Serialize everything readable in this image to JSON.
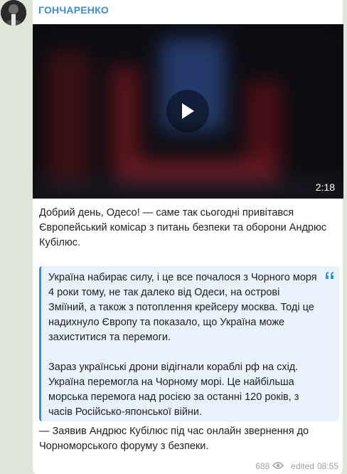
{
  "channel": {
    "author": "ГОНЧАРЕНКО"
  },
  "video": {
    "duration": "2:18"
  },
  "message": {
    "intro": "Добрий день, Одесо! — саме так сьогодні привітався Європейський комісар з питань безпеки та оборони Андрюс Кубілюс.",
    "quote_paragraph_1": "Україна набирає силу, і це все почалося з Чорного моря 4 роки тому, не так далеко від Одеси, на острові Зміїний, а також з потоплення крейсеру москва. Тоді це надихнуло Європу та показало, що Україна може захиститися та перемоги.",
    "quote_paragraph_2": "Зараз українські дрони відігнали кораблі рф на схід. Україна перемогла на Чорному морі. Це найбільша морська перемога над росією за останні 120 років, з часів Російсько-японської війни.",
    "outro": "— Заявив Андрюс Кубілюс під час онлайн звернення до Чорноморського форуму з безпеки."
  },
  "footer": {
    "views": "688",
    "edited_label": "edited",
    "time": "08:55"
  },
  "icons": {
    "play": "play-icon",
    "quote": "quote-icon",
    "views": "eye-icon"
  },
  "colors": {
    "accent": "#3a8fd0",
    "quote_bg": "#e9f2fb",
    "meta": "#9aa3aa"
  }
}
